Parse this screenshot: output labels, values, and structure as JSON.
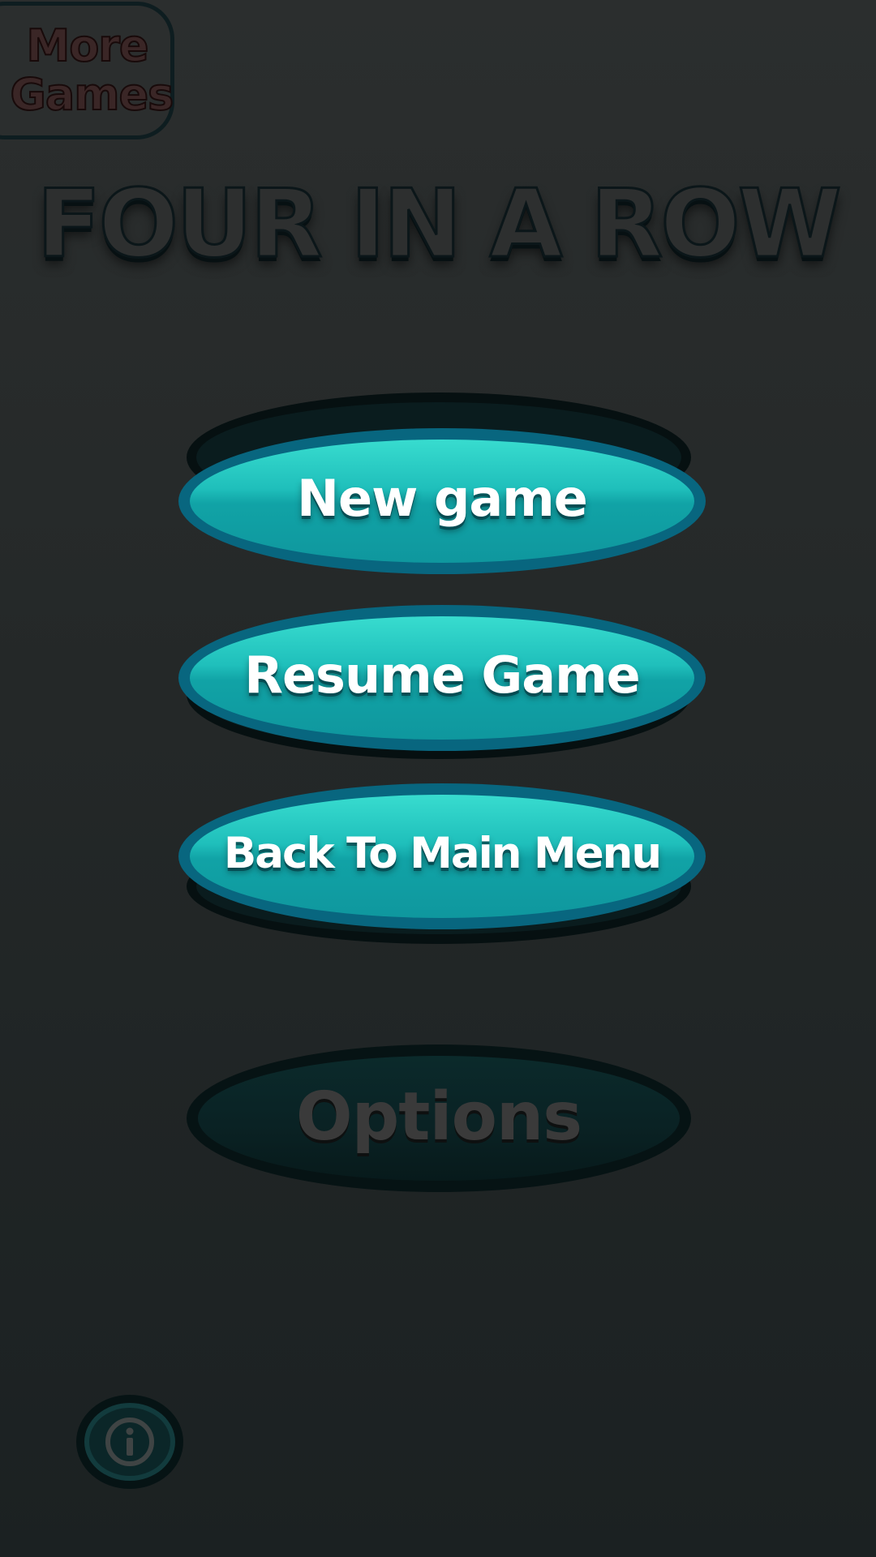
{
  "app": {
    "title": "FOUR IN A ROW"
  },
  "more_games": {
    "label": "More Games"
  },
  "menu": {
    "new_game": "New game",
    "resume_game": "Resume Game",
    "back_to_main_menu": "Back To Main Menu",
    "options": "Options"
  },
  "icons": {
    "info": "info-icon"
  },
  "colors": {
    "button_face_top": "#38dccf",
    "button_face_bottom": "#0f979e",
    "button_rim": "#08667f",
    "background": "#2b2e2e",
    "options_disabled": "#0a2224"
  }
}
